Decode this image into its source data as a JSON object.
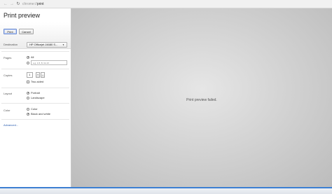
{
  "browser": {
    "url_scheme": "chrome://",
    "url_host": "print",
    "back_icon": "arrow-left",
    "forward_icon": "arrow-right",
    "reload_icon": "reload"
  },
  "sidebar": {
    "title": "Print preview",
    "print_label": "Print",
    "cancel_label": "Cancel",
    "destination": {
      "label": "Destination",
      "value": "HP Officejet J4680 S..."
    },
    "pages": {
      "label": "Pages",
      "all_label": "All",
      "range_placeholder": "e.g. 1-5, 8, 11-13"
    },
    "copies": {
      "label": "Copies",
      "value": "1",
      "plus": "+",
      "minus": "–",
      "two_sided_label": "Two-sided"
    },
    "layout": {
      "label": "Layout",
      "portrait_label": "Portrait",
      "landscape_label": "Landscape"
    },
    "color": {
      "label": "Color",
      "color_label": "Color",
      "bw_label": "Black and white"
    },
    "advanced_label": "Advanced..."
  },
  "preview": {
    "message": "Print preview failed."
  },
  "colors": {
    "accent_blue": "#2a5db0",
    "preview_bg": "#d3d3d3"
  }
}
